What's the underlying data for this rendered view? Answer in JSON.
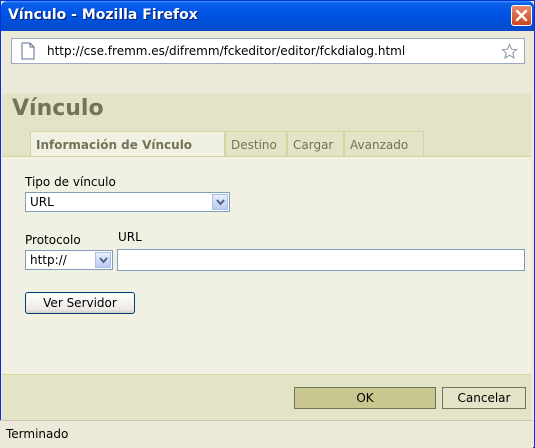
{
  "window": {
    "title": "Vínculo - Mozilla Firefox"
  },
  "urlbar": {
    "url": "http://cse.fremm.es/difremm/fckeditor/editor/fckdialog.html"
  },
  "dialog": {
    "title": "Vínculo"
  },
  "tabs": [
    {
      "label": "Información de Vínculo",
      "active": true
    },
    {
      "label": "Destino",
      "active": false
    },
    {
      "label": "Cargar",
      "active": false
    },
    {
      "label": "Avanzado",
      "active": false
    }
  ],
  "form": {
    "link_type_label": "Tipo de vínculo",
    "link_type_value": "URL",
    "protocol_label": "Protocolo",
    "protocol_value": "http://",
    "url_label": "URL",
    "url_value": "",
    "browse_server_label": "Ver Servidor"
  },
  "footer": {
    "ok_label": "OK",
    "cancel_label": "Cancelar"
  },
  "status": {
    "text": "Terminado"
  },
  "icons": {
    "close": "close-icon",
    "page": "page-icon",
    "bookmark": "star-icon",
    "dropdown": "chevron-down-icon"
  }
}
